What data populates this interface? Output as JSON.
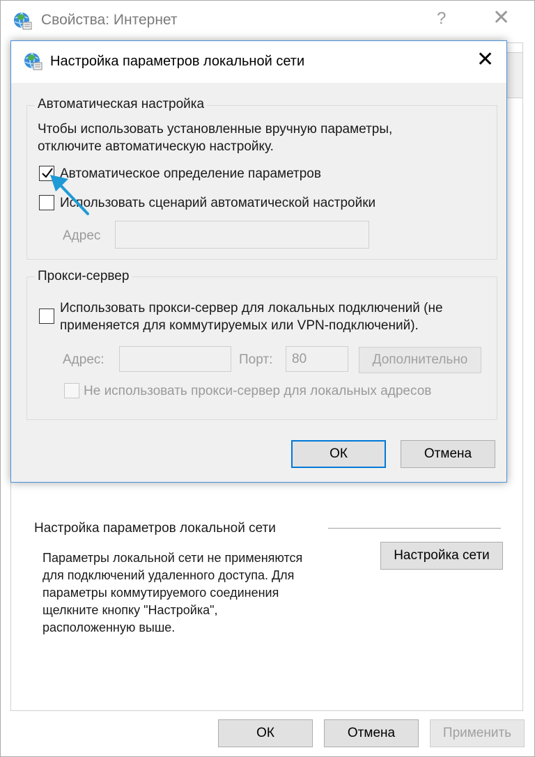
{
  "outer_window": {
    "title": "Свойства: Интернет",
    "help_glyph": "?",
    "close_glyph": "✕",
    "lan_section": {
      "title": "Настройка параметров локальной сети",
      "description": "Параметры локальной сети не применяются\nдля подключений удаленного доступа. Для\nпараметры коммутируемого соединения\nщелкните кнопку \"Настройка\",\nрасположенную выше.",
      "settings_button": "Настройка сети"
    },
    "buttons": {
      "ok": "ОК",
      "cancel": "Отмена",
      "apply": "Применить"
    }
  },
  "dialog": {
    "title": "Настройка параметров локальной сети",
    "close_glyph": "✕",
    "auto_config": {
      "group_title": "Автоматическая настройка",
      "hint_line1": "Чтобы использовать установленные вручную параметры,",
      "hint_line2": "отключите автоматическую настройку.",
      "auto_detect_label": "Автоматическое определение параметров",
      "auto_detect_checked": true,
      "use_script_label": "Использовать сценарий автоматической настройки",
      "use_script_checked": false,
      "address_label": "Адрес",
      "address_value": ""
    },
    "proxy": {
      "group_title": "Прокси-сервер",
      "use_proxy_line1": "Использовать прокси-сервер для локальных подключений (не",
      "use_proxy_line2": "применяется для коммутируемых или VPN-подключений).",
      "use_proxy_checked": false,
      "address_label": "Адрес:",
      "address_value": "",
      "port_label": "Порт:",
      "port_value": "80",
      "advanced_button": "Дополнительно",
      "bypass_local_label": "Не использовать прокси-сервер для локальных адресов",
      "bypass_local_checked": false
    },
    "buttons": {
      "ok": "ОК",
      "cancel": "Отмена"
    }
  },
  "colors": {
    "accent_blue": "#0078d7",
    "arrow_cyan": "#1e9ad6",
    "dialog_border": "#4a90d9"
  },
  "icons": [
    "internet-options-icon",
    "close-icon",
    "help-icon",
    "check-icon",
    "pointer-arrow-icon"
  ]
}
